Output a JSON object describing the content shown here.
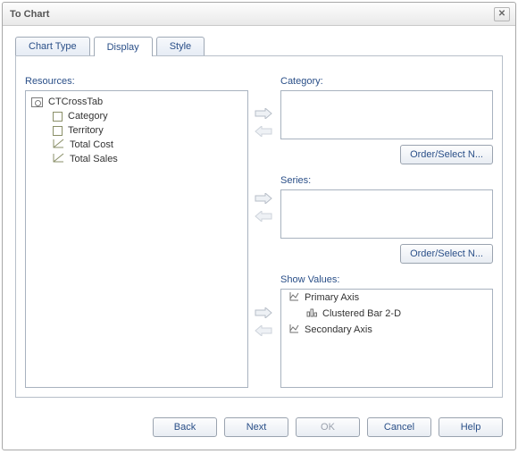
{
  "window": {
    "title": "To Chart",
    "close_symbol": "✕"
  },
  "tabs": {
    "chart_type": "Chart Type",
    "display": "Display",
    "style": "Style",
    "active": "display"
  },
  "labels": {
    "resources": "Resources:",
    "category": "Category:",
    "series": "Series:",
    "show_values": "Show Values:",
    "order_select": "Order/Select N..."
  },
  "resources": {
    "root": "CTCrossTab",
    "children": [
      {
        "label": "Category",
        "kind": "field"
      },
      {
        "label": "Territory",
        "kind": "field"
      },
      {
        "label": "Total Cost",
        "kind": "measure"
      },
      {
        "label": "Total Sales",
        "kind": "measure"
      }
    ]
  },
  "category_box": {
    "items": []
  },
  "series_box": {
    "items": []
  },
  "show_values_box": {
    "items": [
      {
        "label": "Primary Axis",
        "kind": "axis"
      },
      {
        "label": "Clustered Bar 2-D",
        "kind": "bar",
        "indent": true
      },
      {
        "label": "Secondary Axis",
        "kind": "axis"
      }
    ]
  },
  "buttons": {
    "back": "Back",
    "next": "Next",
    "ok": "OK",
    "cancel": "Cancel",
    "help": "Help",
    "ok_enabled": false
  }
}
